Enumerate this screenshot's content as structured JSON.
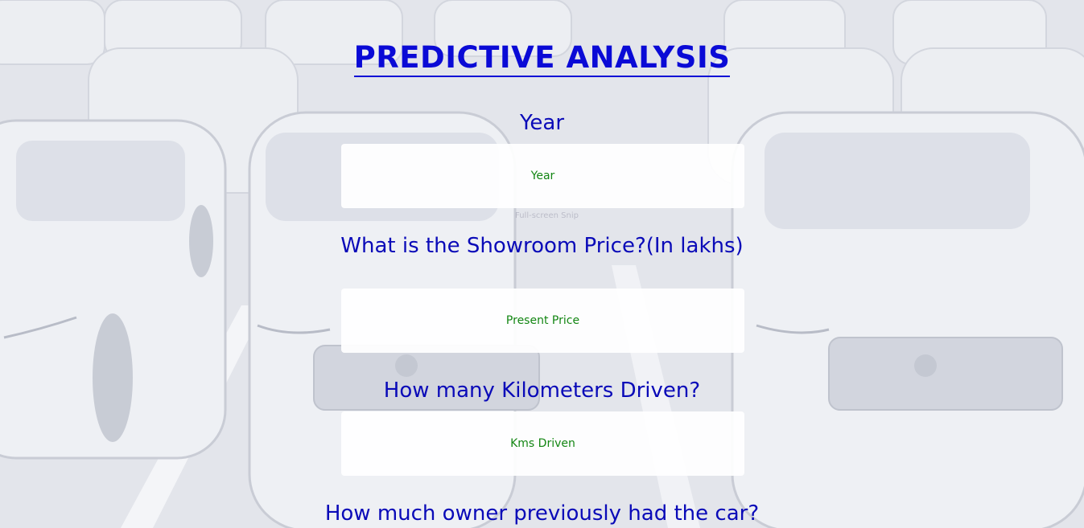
{
  "page": {
    "title": "PREDICTIVE ANALYSIS",
    "overlay_text": "Full-screen Snip"
  },
  "form": {
    "year": {
      "label": "Year",
      "placeholder": "Year",
      "value": ""
    },
    "present_price": {
      "label": "What is the Showroom Price?(In lakhs)",
      "placeholder": "Present Price",
      "value": ""
    },
    "kms_driven": {
      "label": "How many Kilometers Driven?",
      "placeholder": "Kms Driven",
      "value": ""
    },
    "owner": {
      "label": "How much owner previously had the car?"
    }
  },
  "colors": {
    "heading": "#0a0ad6",
    "label": "#0a0ab8",
    "placeholder": "#138613",
    "field_bg": "#ffffff"
  }
}
